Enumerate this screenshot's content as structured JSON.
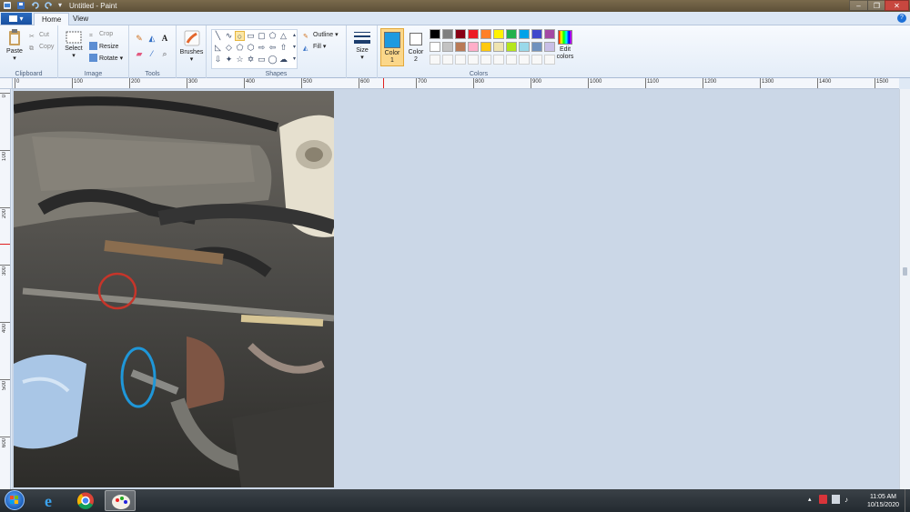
{
  "window": {
    "title": "Untitled - Paint"
  },
  "quick_access": {
    "save_icon": "save-icon",
    "undo_icon": "undo-icon",
    "redo_icon": "redo-icon",
    "customize_icon": "chevron-down-icon"
  },
  "tabs": {
    "file_label": "▾",
    "home_label": "Home",
    "view_label": "View"
  },
  "ribbon": {
    "clipboard": {
      "label": "Clipboard",
      "paste": "Paste",
      "cut": "Cut",
      "copy": "Copy"
    },
    "image": {
      "label": "Image",
      "select": "Select",
      "crop": "Crop",
      "resize": "Resize",
      "rotate": "Rotate"
    },
    "tools": {
      "label": "Tools"
    },
    "brushes": {
      "label": "Brushes"
    },
    "shapes": {
      "label": "Shapes",
      "outline": "Outline",
      "fill": "Fill"
    },
    "size": {
      "label": "Size"
    },
    "colors": {
      "label": "Colors",
      "color1_label": "Color",
      "color1_num": "1",
      "color2_label": "Color",
      "color2_num": "2",
      "edit_label": "Edit",
      "edit_label2": "colors",
      "color1": "#1e9ae0",
      "color2": "#ffffff",
      "palette_row1": [
        "#000000",
        "#7f7f7f",
        "#880015",
        "#ed1c24",
        "#ff7f27",
        "#fff200",
        "#22b14c",
        "#00a2e8",
        "#3f48cc",
        "#a349a4"
      ],
      "palette_row2": [
        "#ffffff",
        "#c3c3c3",
        "#b97a57",
        "#ffaec9",
        "#ffc90e",
        "#efe4b0",
        "#b5e61d",
        "#99d9ea",
        "#7092be",
        "#c8bfe7"
      ]
    }
  },
  "ruler": {
    "h_ticks": [
      "0",
      "100",
      "200",
      "300",
      "400",
      "500",
      "600",
      "700",
      "800",
      "900",
      "1000",
      "1100",
      "1200",
      "1300",
      "1400",
      "1500"
    ],
    "v_ticks": [
      "0",
      "100",
      "200",
      "300",
      "400",
      "500",
      "600"
    ]
  },
  "taskbar": {
    "start_icon": "windows-start-icon",
    "apps": [
      "internet-explorer-icon",
      "chrome-icon",
      "paint-icon"
    ],
    "time": "11:05 AM",
    "date": "10/15/2020"
  }
}
